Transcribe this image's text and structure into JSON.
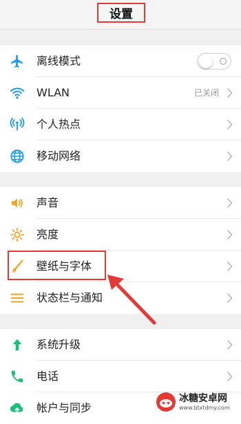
{
  "header": {
    "title": "设置"
  },
  "groups": [
    {
      "items": [
        {
          "icon": "airplane-icon",
          "label": "离线模式",
          "toggle": false
        },
        {
          "icon": "wifi-icon",
          "label": "WLAN",
          "value": "已关闭"
        },
        {
          "icon": "hotspot-icon",
          "label": "个人热点"
        },
        {
          "icon": "globe-icon",
          "label": "移动网络"
        }
      ]
    },
    {
      "items": [
        {
          "icon": "speaker-icon",
          "label": "声音"
        },
        {
          "icon": "brightness-icon",
          "label": "亮度"
        },
        {
          "icon": "brush-icon",
          "label": "壁纸与字体"
        },
        {
          "icon": "status-bar-icon",
          "label": "状态栏与通知"
        }
      ]
    },
    {
      "items": [
        {
          "icon": "upgrade-arrow-icon",
          "label": "系统升级"
        },
        {
          "icon": "phone-icon",
          "label": "电话"
        },
        {
          "icon": "cloud-sync-icon",
          "label": "帐户与同步"
        }
      ]
    }
  ],
  "watermark": {
    "name": "冰糖安卓网",
    "url": "www.btxtdmy.com"
  },
  "colors": {
    "icon_blue": "#1e9be8",
    "icon_orange": "#f5a623",
    "icon_green": "#1bbf7a",
    "annotation_red": "#e53935"
  }
}
